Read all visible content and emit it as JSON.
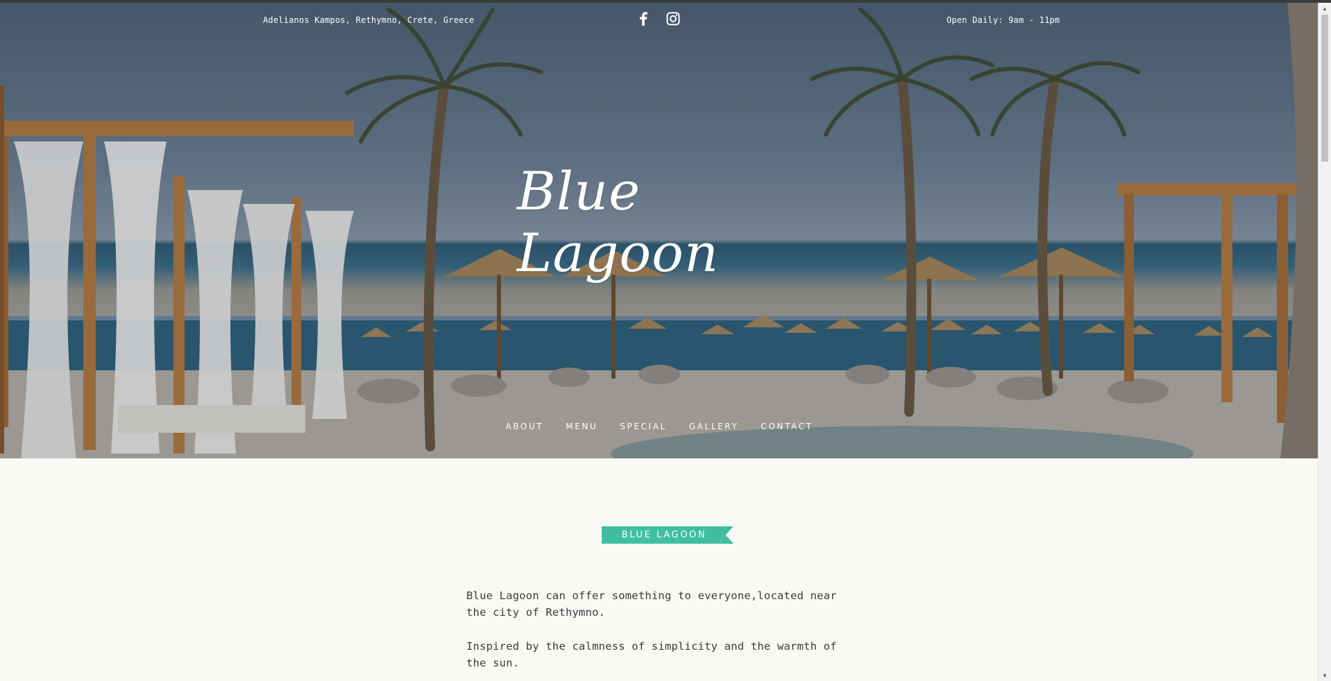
{
  "topbar": {
    "address": "Adelianos Kampos, Rethymno, Crete, Greece",
    "hours": "Open Daily: 9am - 11pm",
    "social": [
      {
        "icon": "facebook-icon",
        "glyph": "f"
      },
      {
        "icon": "instagram-icon",
        "glyph": ""
      }
    ]
  },
  "hero": {
    "logo_text": "Blue Lagoon"
  },
  "nav": {
    "items": [
      "ABOUT",
      "MENU",
      "SPECIAL",
      "GALLERY",
      "CONTACT"
    ]
  },
  "section": {
    "ribbon_label": "BLUE LAGOON",
    "paragraphs": [
      "Blue Lagoon can offer something to everyone,located near the city of Rethymno.",
      "Inspired by the calmness of simplicity and the warmth of the sun."
    ]
  },
  "colors": {
    "accent": "#3fbf9f",
    "text": "#3b3b3b",
    "background": "#faf9f6"
  }
}
